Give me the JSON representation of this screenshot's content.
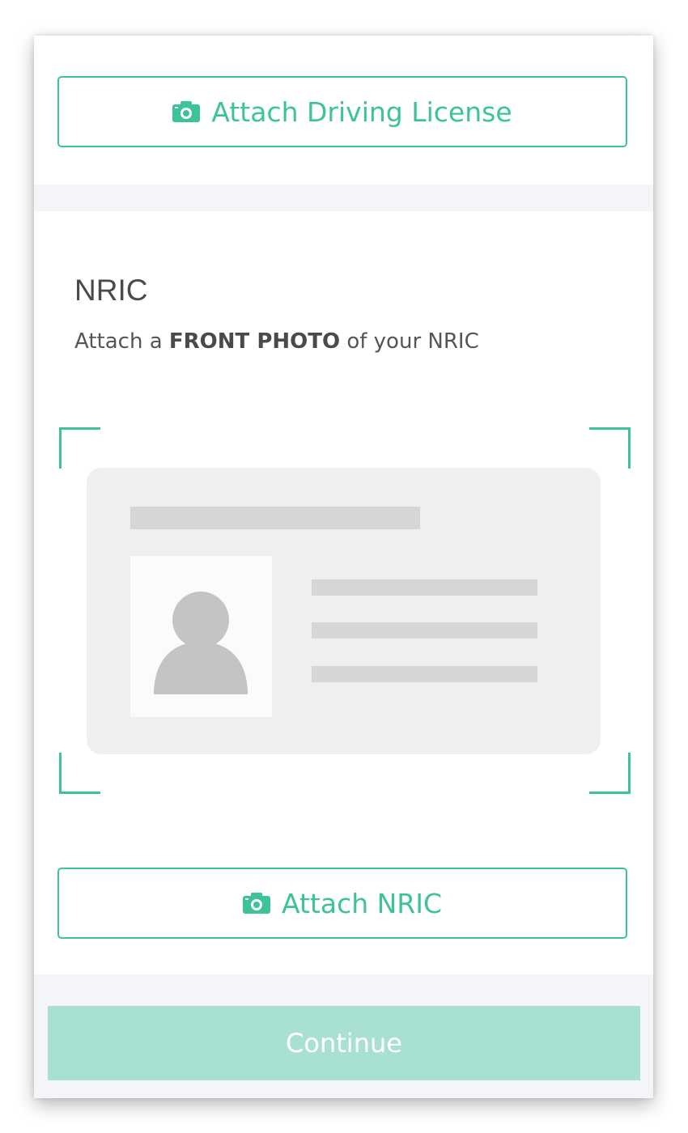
{
  "driving_license": {
    "button_label": "Attach Driving License",
    "icon": "camera-icon"
  },
  "nric": {
    "title": "NRIC",
    "subtitle_prefix": "Attach a ",
    "subtitle_bold": "FRONT PHOTO",
    "subtitle_suffix": " of your NRIC",
    "button_label": "Attach NRIC",
    "illustration_icon": "id-card-placeholder-icon"
  },
  "footer": {
    "continue_label": "Continue",
    "continue_state": "disabled"
  },
  "colors": {
    "accent": "#3cc39a",
    "accent_disabled": "#a9e0d4",
    "divider_bg": "#f4f5f9",
    "card_bg": "#efeff1",
    "placeholder_gray": "#d6d6d6"
  }
}
